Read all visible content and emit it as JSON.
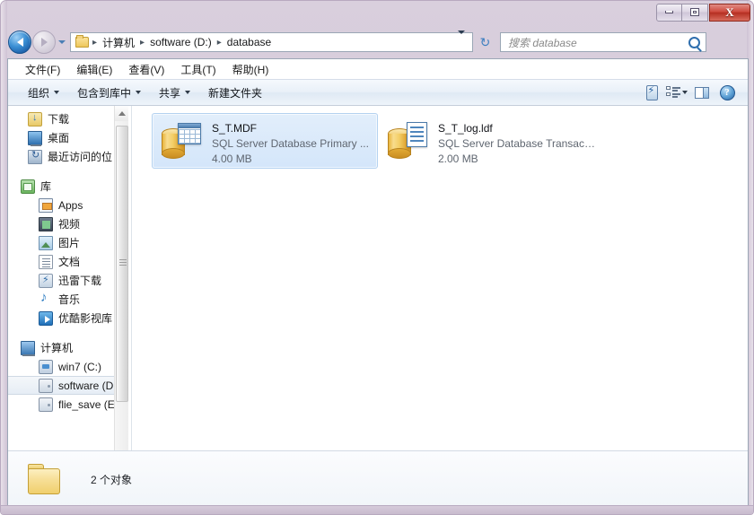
{
  "window": {
    "controls": {
      "minimize": "—",
      "maximize": "□",
      "close": "X"
    }
  },
  "navigation": {
    "back_label": "◀",
    "forward_label": "▶",
    "history_label": "▾",
    "refresh_label": "↻",
    "breadcrumb": [
      {
        "label": "计算机"
      },
      {
        "label": "software (D:)"
      },
      {
        "label": "database"
      }
    ],
    "breadcrumb_separator": "▸",
    "address_caret": "▾"
  },
  "search": {
    "placeholder": "搜索 database"
  },
  "menubar": {
    "items": [
      {
        "label": "文件(F)"
      },
      {
        "label": "编辑(E)"
      },
      {
        "label": "查看(V)"
      },
      {
        "label": "工具(T)"
      },
      {
        "label": "帮助(H)"
      }
    ]
  },
  "toolbar": {
    "buttons": [
      {
        "label": "组织",
        "has_caret": true
      },
      {
        "label": "包含到库中",
        "has_caret": true
      },
      {
        "label": "共享",
        "has_caret": true
      },
      {
        "label": "新建文件夹",
        "has_caret": false
      }
    ],
    "right_icons": [
      {
        "name": "burn-icon"
      },
      {
        "name": "change-view-icon"
      },
      {
        "name": "preview-pane-icon"
      },
      {
        "name": "help-icon",
        "label": "?"
      }
    ]
  },
  "sidebar": {
    "favorites": [
      {
        "label": "下载",
        "icon": "download-icon"
      },
      {
        "label": "桌面",
        "icon": "desktop-icon"
      },
      {
        "label": "最近访问的位",
        "icon": "recent-places-icon"
      }
    ],
    "libraries_header": {
      "label": "库",
      "icon": "library-icon"
    },
    "libraries": [
      {
        "label": "Apps",
        "icon": "apps-icon"
      },
      {
        "label": "视频",
        "icon": "video-icon"
      },
      {
        "label": "图片",
        "icon": "picture-icon"
      },
      {
        "label": "文档",
        "icon": "document-icon"
      },
      {
        "label": "迅雷下载",
        "icon": "thunder-download-icon"
      },
      {
        "label": "音乐",
        "icon": "music-icon"
      },
      {
        "label": "优酷影视库",
        "icon": "youku-icon"
      }
    ],
    "computer_header": {
      "label": "计算机",
      "icon": "computer-icon"
    },
    "drives": [
      {
        "label": "win7 (C:)",
        "icon": "system-drive-icon",
        "selected": false
      },
      {
        "label": "software (D:)",
        "icon": "drive-icon",
        "selected": true
      },
      {
        "label": "flie_save (E:)",
        "icon": "drive-icon",
        "selected": false
      }
    ]
  },
  "files": [
    {
      "name": "S_T.MDF",
      "type": "SQL Server Database Primary ...",
      "size": "4.00 MB",
      "icon": "database-primary-file-icon",
      "selected": true
    },
    {
      "name": "S_T_log.ldf",
      "type": "SQL Server Database Transact...",
      "size": "2.00 MB",
      "icon": "database-log-file-icon",
      "selected": false
    }
  ],
  "details": {
    "item_count": "2 个对象",
    "folder_icon": "folder-icon"
  },
  "colors": {
    "frame": "#d5c9da",
    "close_button": "#cf4a3e",
    "selection": "#d4e6fa",
    "toolbar": "#e9f0f8"
  }
}
